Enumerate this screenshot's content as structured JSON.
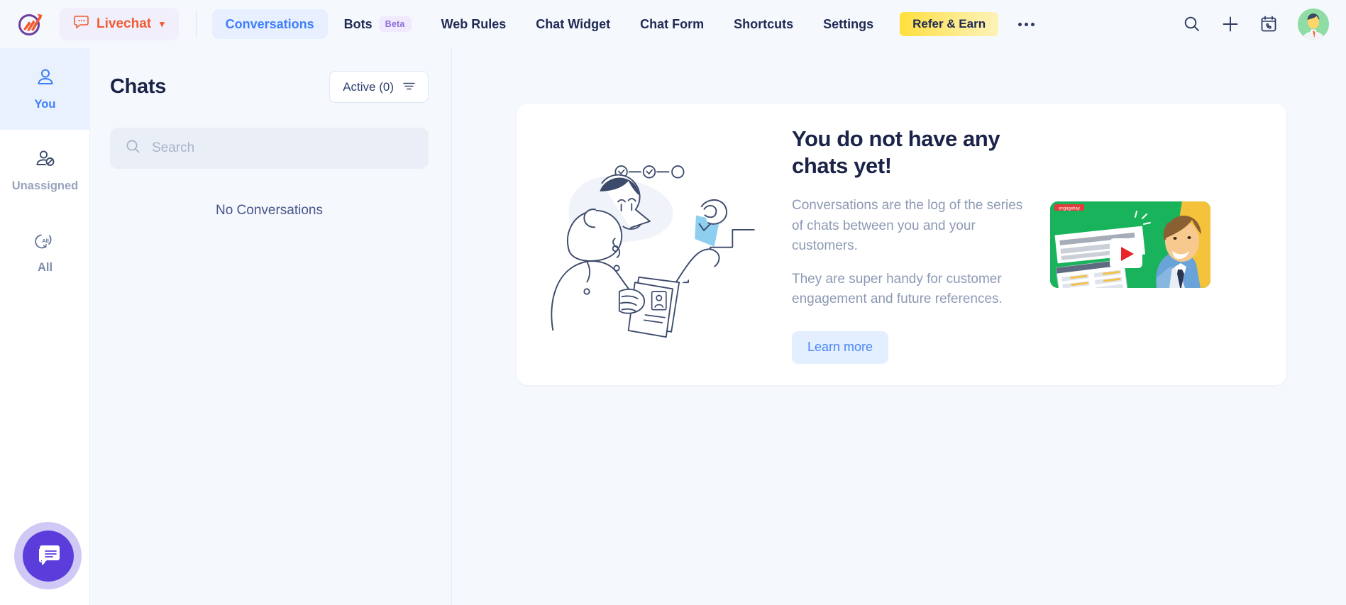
{
  "topbar": {
    "logo_name": "logo-icon",
    "product": {
      "label": "Livechat",
      "icon": "chat-bubble-icon",
      "caret": "⌄"
    },
    "nav": [
      {
        "id": "conversations",
        "label": "Conversations",
        "active": true
      },
      {
        "id": "bots",
        "label": "Bots",
        "badge": "Beta",
        "active": false
      },
      {
        "id": "web-rules",
        "label": "Web Rules",
        "active": false
      },
      {
        "id": "chat-widget",
        "label": "Chat Widget",
        "active": false
      },
      {
        "id": "chat-form",
        "label": "Chat Form",
        "active": false
      },
      {
        "id": "shortcuts",
        "label": "Shortcuts",
        "active": false
      },
      {
        "id": "settings",
        "label": "Settings",
        "active": false
      }
    ],
    "refer": {
      "label": "Refer & Earn",
      "color_start": "#ffdf3d",
      "color_end": "#fdf2b8"
    },
    "overflow": "…",
    "icons": [
      "search-icon",
      "plus-icon",
      "calendar-call-icon",
      "avatar"
    ]
  },
  "rail": {
    "items": [
      {
        "id": "you",
        "label": "You",
        "icon": "person-icon",
        "active": true
      },
      {
        "id": "unassigned",
        "label": "Unassigned",
        "icon": "person-blocked-icon",
        "active": false
      },
      {
        "id": "all",
        "label": "All",
        "icon": "all-arrow-icon",
        "active": false
      }
    ]
  },
  "chats": {
    "title": "Chats",
    "filter": {
      "label": "Active (0)",
      "icon": "filter-icon"
    },
    "search": {
      "value": "",
      "placeholder": "Search",
      "icon": "search-icon"
    },
    "empty_list_text": "No Conversations"
  },
  "main": {
    "heading": "You do not have any chats yet!",
    "paragraph1": "Conversations are the log of the series of chats between you and your customers.",
    "paragraph2": "They are super handy for customer engagement and future references.",
    "learn_more": "Learn more",
    "illustration_name": "person-with-documents-illustration",
    "video_name": "intro-video-thumbnail"
  },
  "widget": {
    "name": "chat-widget-bubble",
    "icon": "chat-icon",
    "color": "#5b3ddb"
  },
  "theme": {
    "accent_blue": "#3d7efc",
    "brand_orange": "#f15b33",
    "brand_purple": "#5b3ddb",
    "text_dark": "#1b2448",
    "text_muted": "#8d99b4",
    "page_bg": "#f5f8fc"
  }
}
